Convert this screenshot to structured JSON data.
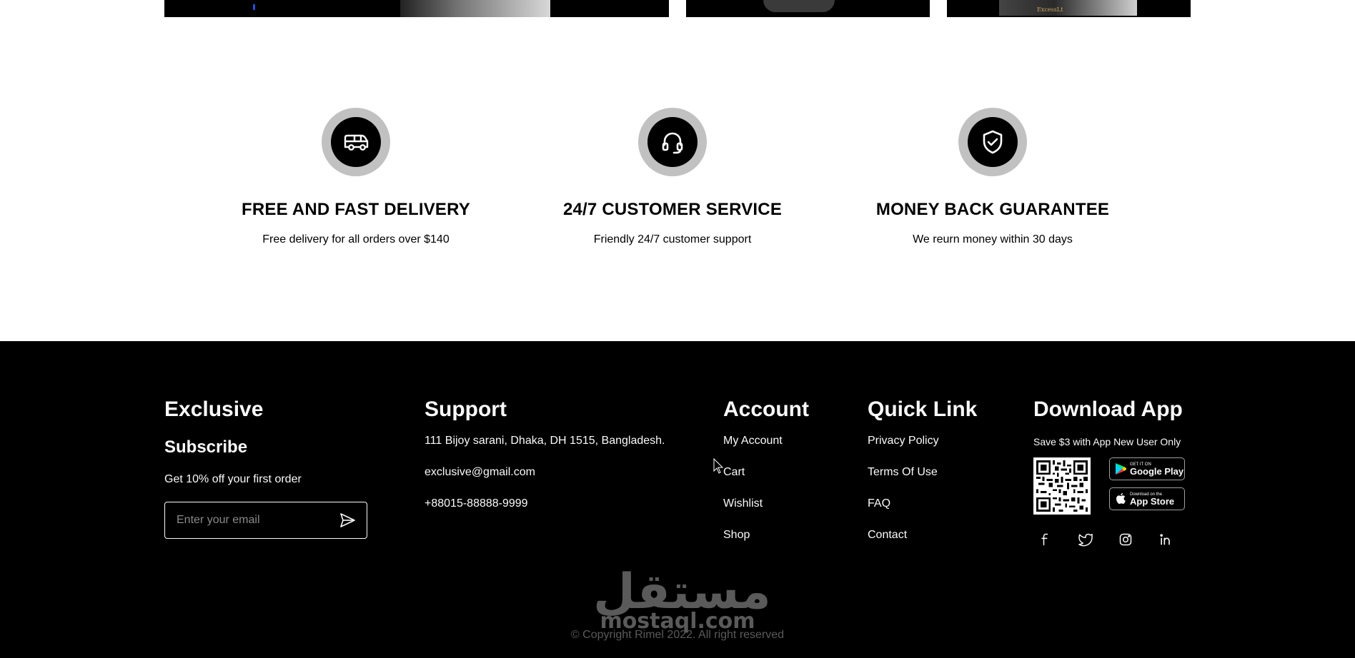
{
  "services": [
    {
      "icon": "delivery-van-icon",
      "title": "FREE AND FAST DELIVERY",
      "desc": "Free delivery for all orders over $140"
    },
    {
      "icon": "headset-icon",
      "title": "24/7 CUSTOMER SERVICE",
      "desc": "Friendly 24/7 customer support"
    },
    {
      "icon": "shield-check-icon",
      "title": "MONEY BACK GUARANTEE",
      "desc": "We reurn money within 30 days"
    }
  ],
  "top_images": {
    "box_label": "ExcessLt"
  },
  "footer": {
    "exclusive": {
      "title": "Exclusive",
      "subtitle": "Subscribe",
      "offer": "Get 10% off your first order",
      "email_placeholder": "Enter your email"
    },
    "support": {
      "title": "Support",
      "address": "111 Bijoy sarani, Dhaka, DH 1515, Bangladesh.",
      "email": "exclusive@gmail.com",
      "phone": "+88015-88888-9999"
    },
    "account": {
      "title": "Account",
      "links": [
        "My Account",
        "Cart",
        "Wishlist",
        "Shop"
      ]
    },
    "quick_link": {
      "title": "Quick Link",
      "links": [
        "Privacy Policy",
        "Terms Of Use",
        "FAQ",
        "Contact"
      ]
    },
    "download_app": {
      "title": "Download App",
      "note": "Save $3 with App New User Only",
      "google_play": {
        "small": "GET IT ON",
        "big": "Google Play"
      },
      "app_store": {
        "small": "Download on the",
        "big": "App Store"
      },
      "socials": [
        "facebook-icon",
        "twitter-icon",
        "instagram-icon",
        "linkedin-icon"
      ]
    },
    "watermark": {
      "arabic": "مستقل",
      "latin": "mostaql.com"
    },
    "copyright": "©  Copyright Rimel 2022. All right reserved"
  },
  "colors": {
    "background": "#ffffff",
    "footer": "#000000",
    "icon_ring": "#c1c1c1",
    "text_light": "#fafafa"
  }
}
